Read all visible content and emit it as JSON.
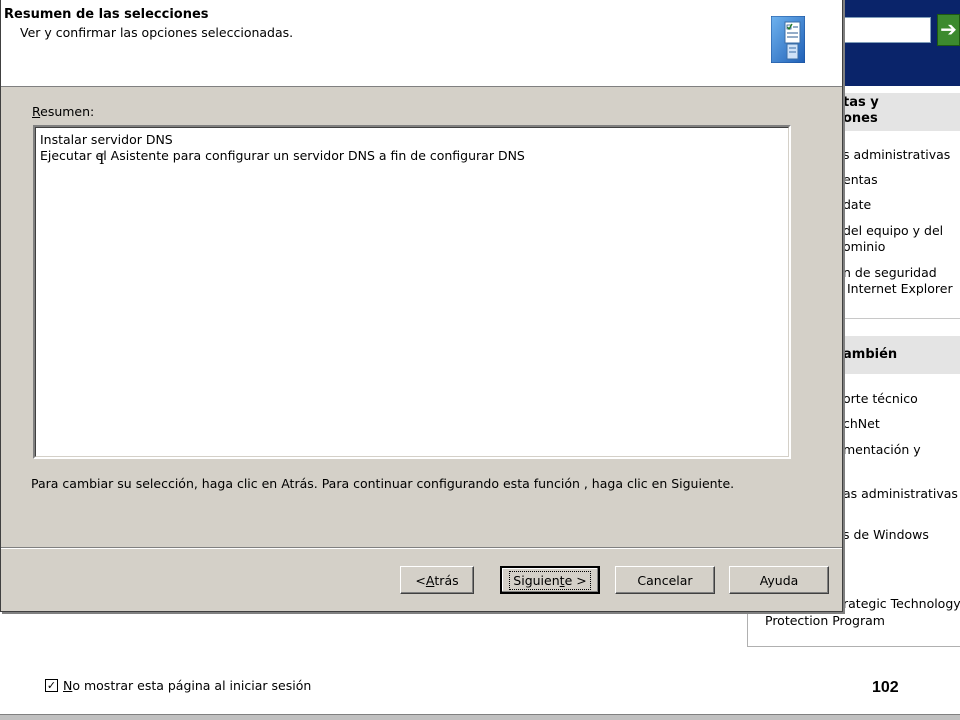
{
  "background_window": {
    "section1_heading": "tas y\nones",
    "section1_links": [
      "s administrativas",
      "entas",
      "date",
      "del equipo y del\nominio",
      "n de seguridad\n Internet Explorer"
    ],
    "section2_heading": "ambién",
    "section2_links": [
      "orte técnico",
      "chNet",
      "mentación y",
      "as administrativas",
      "s de Windows"
    ],
    "tail_line1": "rategic Technology",
    "tail_line2": "Protection Program",
    "checkbox_label_accel": "N",
    "checkbox_label_rest": "o mostrar esta página al iniciar sesión",
    "checkbox_checked": true,
    "page_number": "102"
  },
  "wizard": {
    "header_title": "Resumen de las selecciones",
    "header_subtitle": "Ver y confirmar las opciones seleccionadas.",
    "summary_label_accel": "R",
    "summary_label_rest": "esumen:",
    "summary_lines": [
      "Instalar servidor DNS",
      "Ejecutar el Asistente para configurar un servidor DNS a fin de configurar DNS"
    ],
    "instructions": "Para cambiar su selección, haga clic en Atrás. Para continuar configurando esta función , haga clic en Siguiente.",
    "buttons": {
      "back_prefix": "< ",
      "back_accel": "A",
      "back_rest": "trás",
      "next_prefix": "Siguien",
      "next_accel": "t",
      "next_rest": "e >",
      "cancel": "Cancelar",
      "help": "Ayuda"
    }
  },
  "colors": {
    "titlebar_start": "#0a246a",
    "titlebar_end": "#a6caf0",
    "dialog_face": "#d4d0c8",
    "go_button": "#3c8a2e"
  }
}
